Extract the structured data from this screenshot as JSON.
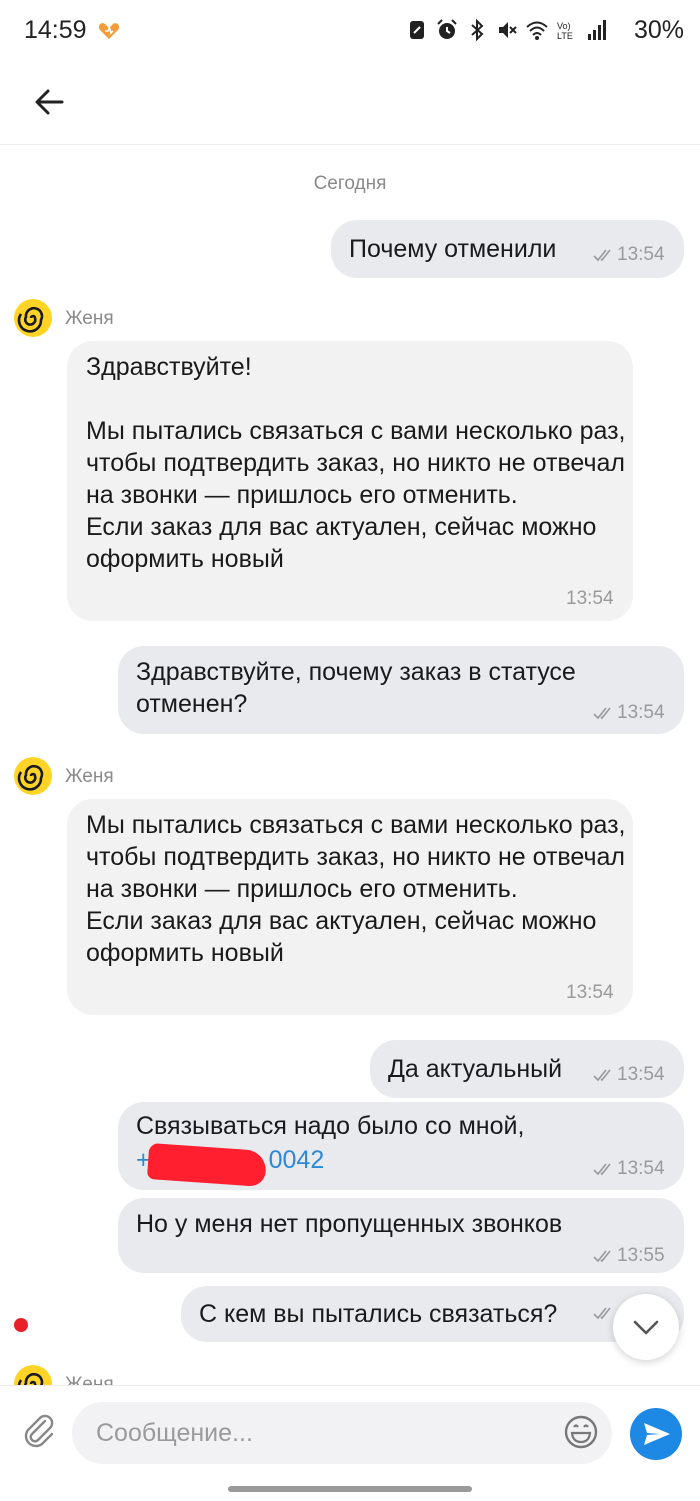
{
  "status_bar": {
    "time": "14:59",
    "battery": "30%",
    "icons": [
      "heart-icon",
      "nfc-icon",
      "alarm-icon",
      "bluetooth-icon",
      "mute-icon",
      "wifi-icon",
      "volte-icon",
      "signal-icon"
    ]
  },
  "header": {
    "back_icon": "arrow-left-icon"
  },
  "chat": {
    "date_separator": "Сегодня",
    "messages": [
      {
        "dir": "out",
        "text": "Почему отменили",
        "time": "13:54",
        "read": true
      },
      {
        "dir": "in",
        "sender": "Женя",
        "text": "Здравствуйте!\n\nМы пытались связаться с вами несколько раз, чтобы подтвердить заказ, но никто не отвечал на звонки — пришлось его отменить.\nЕсли заказ для вас актуален, сейчас можно оформить новый",
        "time": "13:54"
      },
      {
        "dir": "out",
        "text": "Здравствуйте, почему заказ в статусе отменен?",
        "time": "13:54",
        "read": true
      },
      {
        "dir": "in",
        "sender": "Женя",
        "text": "Мы пытались связаться с вами несколько раз, чтобы подтвердить заказ, но никто не отвечал на звонки — пришлось его отменить.\nЕсли заказ для вас актуален, сейчас можно оформить новый",
        "time": "13:54"
      },
      {
        "dir": "out",
        "text": "Да актуальный",
        "time": "13:54",
        "read": true
      },
      {
        "dir": "out",
        "text": "Связываться надо было со мной,",
        "link_start": "+",
        "link_end": "0042",
        "time": "13:54",
        "read": true
      },
      {
        "dir": "out",
        "text": "Но у меня нет пропущенных звонков",
        "time": "13:55",
        "read": true
      },
      {
        "dir": "out",
        "text": "С кем вы пытались связаться?",
        "read": true
      },
      {
        "dir": "in",
        "sender": "Женя"
      }
    ]
  },
  "composer": {
    "placeholder": "Сообщение...",
    "icons": [
      "paperclip-icon",
      "emoji-icon",
      "send-icon"
    ]
  },
  "colors": {
    "accent": "#1e88e5",
    "outgoing_bubble": "#e8eaee",
    "incoming_bubble": "#f2f2f2",
    "avatar": "#ffd426",
    "link": "#2b89d6"
  }
}
